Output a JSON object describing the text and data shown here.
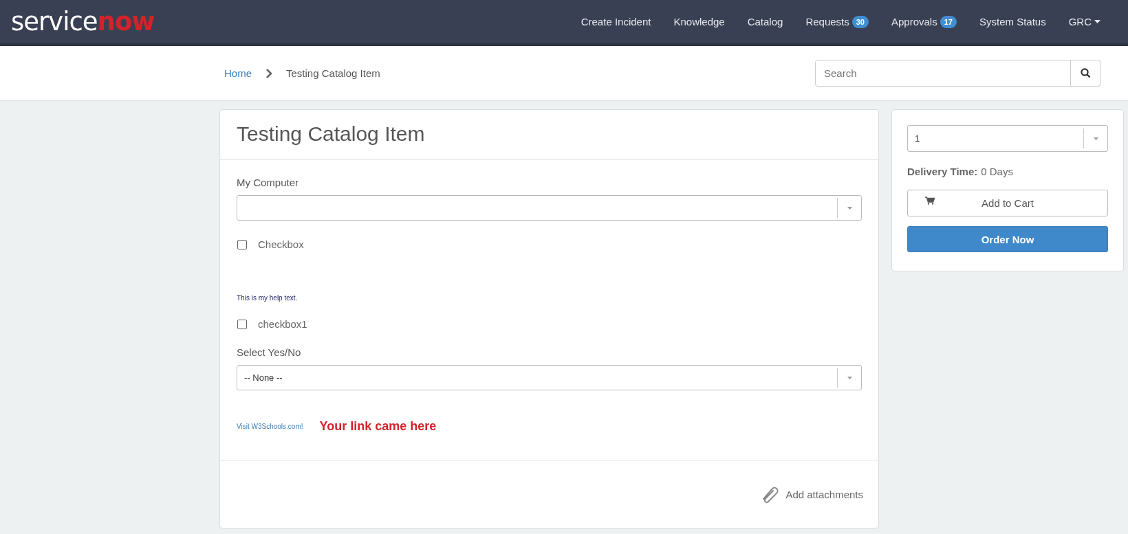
{
  "header": {
    "logo": {
      "main": "service",
      "accent": "now"
    },
    "nav": [
      {
        "label": "Create Incident",
        "kind": "link"
      },
      {
        "label": "Knowledge",
        "kind": "link"
      },
      {
        "label": "Catalog",
        "kind": "link"
      },
      {
        "label": "Requests",
        "kind": "badge",
        "badge": "30"
      },
      {
        "label": "Approvals",
        "kind": "badge",
        "badge": "17"
      },
      {
        "label": "System Status",
        "kind": "link"
      },
      {
        "label": "GRC",
        "kind": "dropdown"
      }
    ]
  },
  "breadcrumb": {
    "items": [
      {
        "label": "Home",
        "kind": "link"
      },
      {
        "label": "Testing Catalog Item",
        "kind": "current"
      }
    ]
  },
  "search": {
    "placeholder": "Search"
  },
  "item": {
    "title": "Testing Catalog Item",
    "fields": [
      {
        "kind": "select",
        "label": "My Computer"
      },
      {
        "kind": "checkbox",
        "label": "Checkbox",
        "checked": false
      },
      {
        "kind": "help",
        "text": "This is my help text."
      },
      {
        "kind": "checkbox",
        "label": "checkbox1",
        "checked": false
      },
      {
        "kind": "select",
        "label": "Select Yes/No",
        "value": "-- None --"
      },
      {
        "kind": "link",
        "link": "Visit W3Schools.com!",
        "note": "Your link came here"
      }
    ],
    "attachments": "Add attachments"
  },
  "order": {
    "quantity": "1",
    "delivery_label": "Delivery Time:",
    "delivery_value": "0 Days",
    "add_to_cart": "Add to Cart",
    "order_now": "Order Now"
  }
}
